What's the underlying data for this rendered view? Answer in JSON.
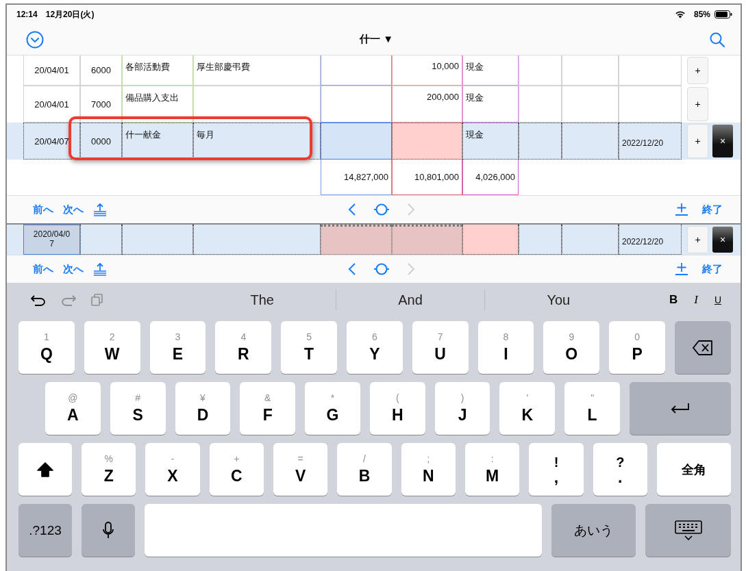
{
  "status_bar": {
    "time": "12:14",
    "date": "12月20日(火)",
    "battery": "85%"
  },
  "nav_bar": {
    "title": "什一",
    "title_caret": "▼"
  },
  "table": {
    "rows": [
      {
        "column_1": "20/04/01",
        "column_2": "6000",
        "column_3": "各部活動費",
        "column_4": "厚生部慶弔費",
        "column_6": "10,000",
        "column_7": "現金",
        "add": "+",
        "selected": false,
        "highlighted": false
      },
      {
        "column_1": "20/04/01",
        "column_2": "7000",
        "column_3": "備品購入支出",
        "column_6": "200,000",
        "column_7": "現金",
        "add": "+",
        "selected": false,
        "highlighted": false
      },
      {
        "column_1": "20/04/07",
        "column_2": "0000",
        "column_3": "什一献金",
        "column_4": "毎月",
        "column_7": "現金",
        "column_10": "2022/12/20",
        "add": "+",
        "delete": "×",
        "selected": true,
        "highlighted": true
      }
    ],
    "totals": {
      "column_5": "14,827,000",
      "column_6": "10,801,000",
      "column_7": "4,026,000"
    }
  },
  "accessory_bars": [
    {
      "prev": "前へ",
      "next": "次へ",
      "done": "終了",
      "forward_enabled": false
    },
    {
      "prev": "前へ",
      "next": "次へ",
      "done": "終了",
      "forward_enabled": false
    }
  ],
  "lower_table": {
    "rows": [
      {
        "column_1": "2020/04/07",
        "column_10": "2022/12/20",
        "add": "+",
        "delete": "×",
        "selected": true,
        "highlighted": false
      }
    ]
  },
  "keyboard": {
    "toolbar": {
      "undo_enabled": true,
      "redo_enabled": false,
      "paste_enabled": false,
      "suggestions": [
        {
          "text": "The"
        },
        {
          "text": "And"
        },
        {
          "text": "You"
        }
      ],
      "format": [
        {
          "kind": "bold",
          "label": "B"
        },
        {
          "kind": "italic",
          "label": "I"
        },
        {
          "kind": "underline",
          "label": "U"
        }
      ]
    },
    "rows": [
      [
        {
          "kind": "letter",
          "hint": "1",
          "label": "Q"
        },
        {
          "kind": "letter",
          "hint": "2",
          "label": "W"
        },
        {
          "kind": "letter",
          "hint": "3",
          "label": "E"
        },
        {
          "kind": "letter",
          "hint": "4",
          "label": "R"
        },
        {
          "kind": "letter",
          "hint": "5",
          "label": "T"
        },
        {
          "kind": "letter",
          "hint": "6",
          "label": "Y"
        },
        {
          "kind": "letter",
          "hint": "7",
          "label": "U"
        },
        {
          "kind": "letter",
          "hint": "8",
          "label": "I"
        },
        {
          "kind": "letter",
          "hint": "9",
          "label": "O"
        },
        {
          "kind": "letter",
          "hint": "0",
          "label": "P"
        },
        {
          "kind": "delete"
        }
      ],
      [
        {
          "kind": "letter",
          "hint": "@",
          "label": "A"
        },
        {
          "kind": "letter",
          "hint": "#",
          "label": "S"
        },
        {
          "kind": "letter",
          "hint": "¥",
          "label": "D"
        },
        {
          "kind": "letter",
          "hint": "&",
          "label": "F"
        },
        {
          "kind": "letter",
          "hint": "*",
          "label": "G"
        },
        {
          "kind": "letter",
          "hint": "(",
          "label": "H"
        },
        {
          "kind": "letter",
          "hint": ")",
          "label": "J"
        },
        {
          "kind": "letter",
          "hint": "'",
          "label": "K"
        },
        {
          "kind": "letter",
          "hint": "\"",
          "label": "L"
        },
        {
          "kind": "return"
        }
      ],
      [
        {
          "kind": "shift",
          "on": true
        },
        {
          "kind": "letter",
          "hint": "%",
          "label": "Z"
        },
        {
          "kind": "letter",
          "hint": "-",
          "label": "X"
        },
        {
          "kind": "letter",
          "hint": "+",
          "label": "C"
        },
        {
          "kind": "letter",
          "hint": "=",
          "label": "V"
        },
        {
          "kind": "letter",
          "hint": "/",
          "label": "B"
        },
        {
          "kind": "letter",
          "hint": ";",
          "label": "N"
        },
        {
          "kind": "letter",
          "hint": ":",
          "label": "M"
        },
        {
          "kind": "punct",
          "hint": "!",
          "label": ","
        },
        {
          "kind": "punct",
          "hint": "?",
          "label": "."
        },
        {
          "kind": "action",
          "label": "全角"
        }
      ],
      [
        {
          "kind": "mode",
          "label": ".?123"
        },
        {
          "kind": "mic"
        },
        {
          "kind": "space"
        },
        {
          "kind": "kana",
          "label": "あいう"
        },
        {
          "kind": "hide"
        }
      ]
    ]
  }
}
